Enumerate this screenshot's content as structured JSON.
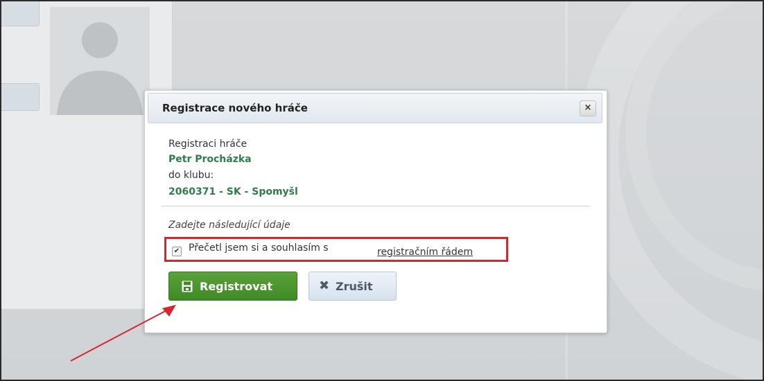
{
  "modal": {
    "title": "Registrace nového hráče",
    "close_label": "×",
    "intro_label": "Registraci hráče",
    "player_name": "Petr Procházka",
    "club_label": "do klubu:",
    "club_value": "2060371 - SK - Spomyšl",
    "instructions": "Zadejte následující údaje",
    "agree_checked": true,
    "agree_text": "Přečetl jsem si a souhlasím s",
    "agree_link": "registračním řádem",
    "register_label": "Registrovat",
    "cancel_label": "Zrušit",
    "register_icon": "save-icon",
    "cancel_icon": "close-icon"
  },
  "colors": {
    "register_button": "#4a9530",
    "highlight_box": "#d7262e",
    "green_text": "#2e7d4a",
    "annotation_arrow": "#d7262e"
  }
}
